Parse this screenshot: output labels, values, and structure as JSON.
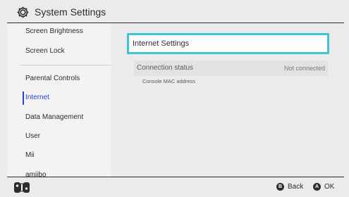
{
  "header": {
    "title": "System Settings",
    "icon": "gear-icon"
  },
  "sidebar": {
    "items": [
      {
        "label": "Screen Brightness"
      },
      {
        "label": "Screen Lock"
      },
      {
        "label": "Parental Controls"
      },
      {
        "label": "Internet",
        "selected": true
      },
      {
        "label": "Data Management"
      },
      {
        "label": "User"
      },
      {
        "label": "Mii"
      },
      {
        "label": "amiibo"
      }
    ]
  },
  "main": {
    "internet_settings_label": "Internet Settings",
    "connection_status_label": "Connection status",
    "connection_status_value": "Not connected",
    "mac_address_label": "Console MAC address"
  },
  "footer": {
    "back_key": "B",
    "back_label": "Back",
    "ok_key": "A",
    "ok_label": "OK",
    "controller_icon": "joycon-icon"
  },
  "colors": {
    "accent": "#2743d8",
    "focus": "#3ec5d1",
    "background": "#ebebeb"
  }
}
